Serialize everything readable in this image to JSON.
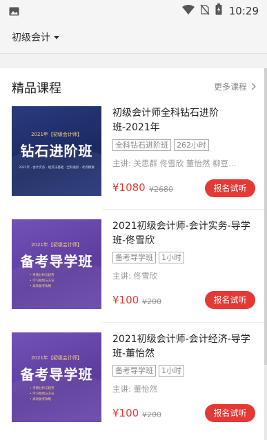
{
  "status_bar": {
    "time": "10:29",
    "icons": [
      "photo-icon",
      "wifi-icon",
      "no-sim-icon",
      "battery-icon"
    ]
  },
  "top_bar": {
    "subject": "初级会计"
  },
  "section": {
    "title": "精品课程",
    "more": "更多课程"
  },
  "courses": [
    {
      "title": "初级会计师全科钻石进阶班-2021年",
      "tags": [
        "全科钻石进阶班",
        "262小时"
      ],
      "teachers": "主讲: 关思群 佟雪欣 董怡然 柳豆…",
      "price": "¥1080",
      "old_price": "¥2680",
      "button": "报名试听",
      "thumb": {
        "year_label": "2021年【初级会计师】",
        "big": "钻石进阶班",
        "line": "2021年 · 会计实务 · 经济法基础 · 全科进阶 · 考点精讲"
      }
    },
    {
      "title": "2021初级会计师-会计实务-导学班-佟雪欣",
      "tags": [
        "备考导学班",
        "1小时"
      ],
      "teachers": "主讲: 佟雪欣",
      "price": "¥100",
      "old_price": "¥200",
      "button": "报名试听",
      "thumb": {
        "year_label": "2021年【初级会计师】",
        "big": "备考导学班",
        "bullets": [
          "• 考情分析与趋势",
          "• 学习规划与方法",
          "• 高效备考攻略"
        ]
      }
    },
    {
      "title": "2021初级会计师-会计经济-导学班-董怡然",
      "tags": [
        "备考导学班",
        "1小时"
      ],
      "teachers": "主讲: 董怡然",
      "price": "¥100",
      "old_price": "¥200",
      "button": "报名试听",
      "thumb": {
        "year_label": "2021年【初级会计师】",
        "big": "备考导学班",
        "bullets": [
          "• 考情分析与趋势",
          "• 学习规划与方法",
          "• 高效备考攻略"
        ]
      }
    }
  ],
  "colors": {
    "accent_red": "#e53935",
    "thumb_blue": "#1b2961",
    "thumb_purple": "#5c3c9c"
  }
}
